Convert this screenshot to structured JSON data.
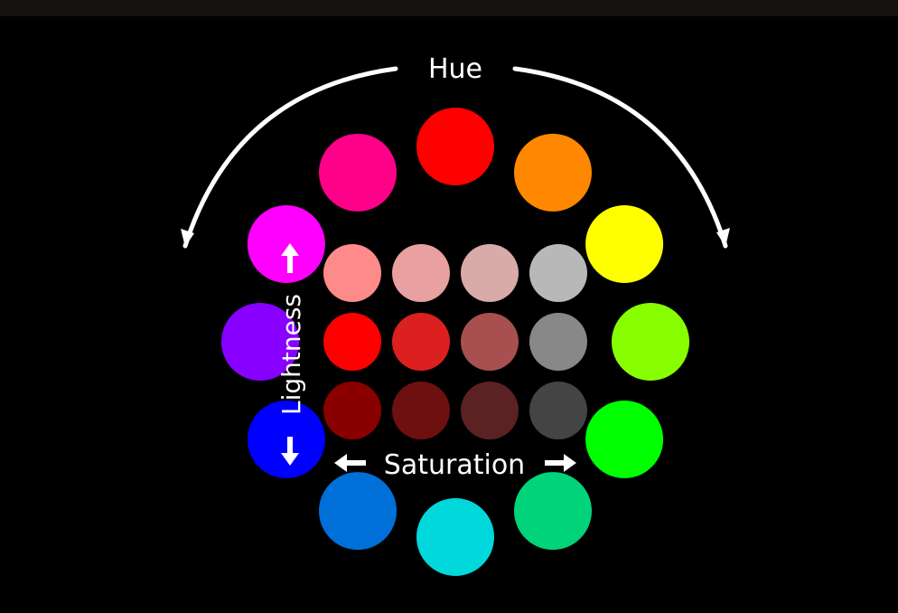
{
  "labels": {
    "hue": "Hue",
    "saturation": "Saturation",
    "lightness": "Lightness"
  },
  "hue_wheel": [
    {
      "name": "red",
      "color": "#ff0000"
    },
    {
      "name": "orange",
      "color": "#ff8800"
    },
    {
      "name": "yellow",
      "color": "#ffff00"
    },
    {
      "name": "chartreuse",
      "color": "#88ff00"
    },
    {
      "name": "green",
      "color": "#00ff00"
    },
    {
      "name": "spring-green",
      "color": "#00d37a"
    },
    {
      "name": "cyan",
      "color": "#00d8dc"
    },
    {
      "name": "azure",
      "color": "#0070d8"
    },
    {
      "name": "blue",
      "color": "#0000ff"
    },
    {
      "name": "violet",
      "color": "#8800ff"
    },
    {
      "name": "magenta",
      "color": "#ff00ff"
    },
    {
      "name": "rose",
      "color": "#ff0088"
    }
  ],
  "grid": [
    [
      "#ff8a8a",
      "#e8a0a0",
      "#d8aaaa",
      "#b8b8b8"
    ],
    [
      "#ff0000",
      "#dc2020",
      "#a85050",
      "#888888"
    ],
    [
      "#8a0000",
      "#6e1010",
      "#5a2222",
      "#444444"
    ]
  ],
  "colors": {
    "background": "#000000",
    "arrow": "#ffffff"
  }
}
